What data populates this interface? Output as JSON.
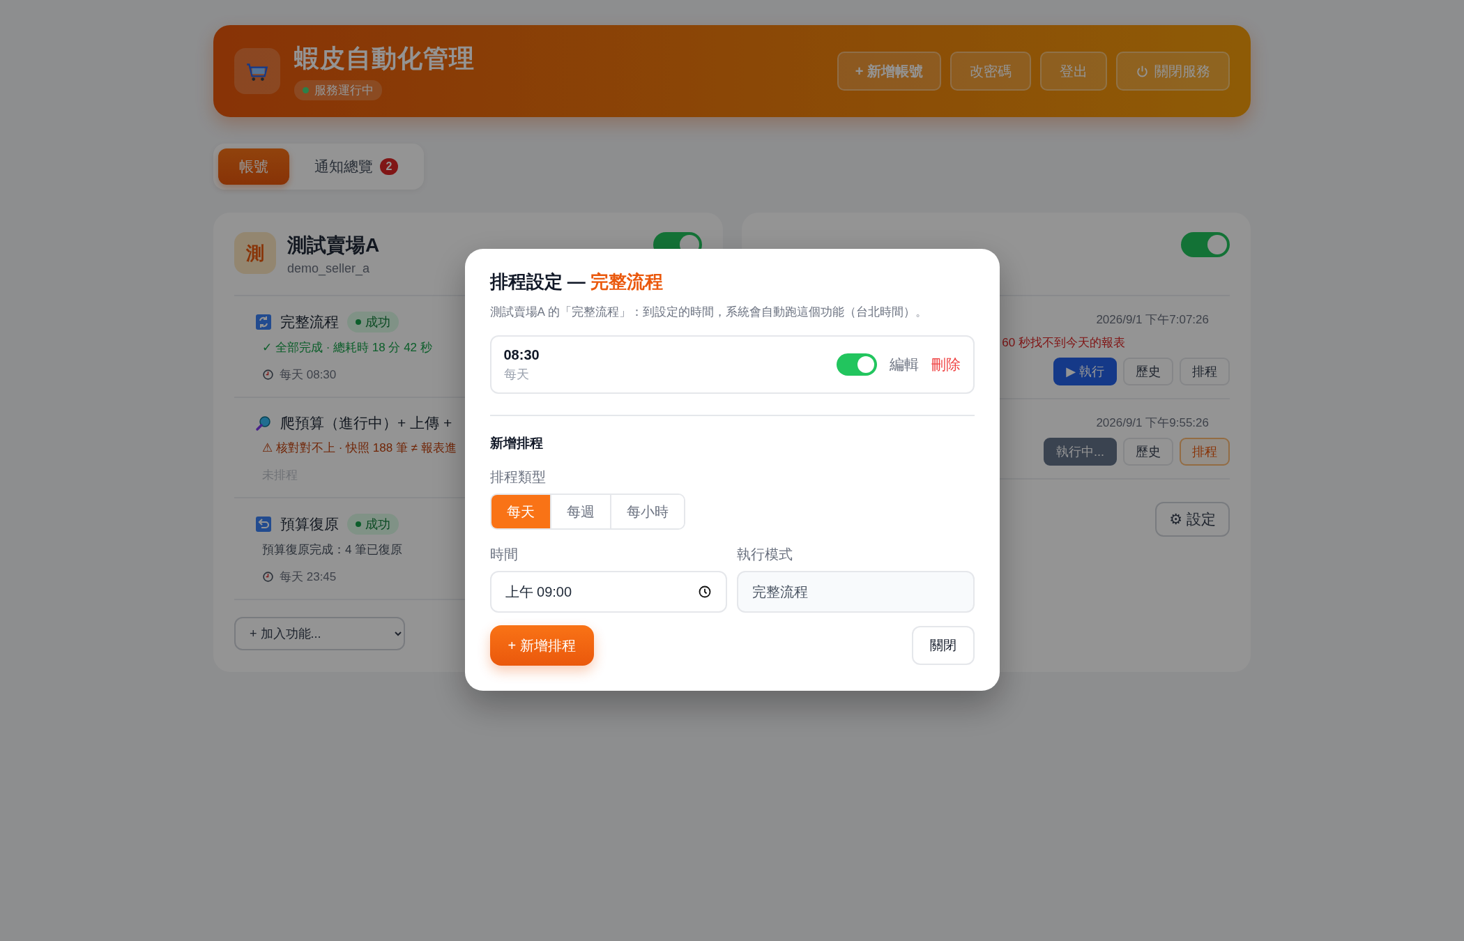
{
  "header": {
    "title": "蝦皮自動化管理",
    "status": "服務運行中",
    "buttons": [
      {
        "kind": "add",
        "label": "+ 新增帳號"
      },
      {
        "kind": "plain",
        "label": "改密碼"
      },
      {
        "kind": "plain",
        "label": "登出"
      },
      {
        "kind": "power",
        "label": "關閉服務"
      }
    ]
  },
  "tabs": [
    {
      "label": "帳號",
      "selected": true
    },
    {
      "label": "通知總覽",
      "selected": false,
      "badge": "2"
    }
  ],
  "accounts": [
    {
      "avatar": "測",
      "name": "測試賣場A",
      "username": "demo_seller_a",
      "enabled": true,
      "tasks": [
        {
          "kind": "success",
          "name": "完整流程",
          "status": "成功",
          "message": "✓ 全部完成 · 總耗時 18 分 42 秒",
          "schedule": "每天 08:30",
          "scheduled": true
        },
        {
          "kind": "warning",
          "name": "爬預算（進行中）+ 上傳 +",
          "message": "⚠ 核對對不上 · 快照 188 筆 ≠ 報表進",
          "schedule": "未排程",
          "scheduled": false
        },
        {
          "kind": "neutral",
          "name": "預算復原",
          "status": "成功",
          "message": "預算復原完成：4 筆已復原",
          "schedule": "每天 23:45",
          "scheduled": true
        }
      ],
      "add_select": "+ 加入功能..."
    },
    {
      "enabled": true,
      "tasks": [
        {
          "kind": "error",
          "time": "2026/9/1 下午7:07:26",
          "message": "60 秒找不到今天的報表",
          "buttons": [
            {
              "kind": "run",
              "label": "▶ 執行",
              "disabled": false
            },
            {
              "kind": "plain",
              "label": "歷史"
            },
            {
              "kind": "plain",
              "label": "排程"
            }
          ]
        },
        {
          "time": "2026/9/1 下午9:55:26",
          "buttons": [
            {
              "kind": "run",
              "label": "執行中...",
              "disabled": true
            },
            {
              "kind": "plain",
              "label": "歷史"
            },
            {
              "kind": "highlight",
              "label": "排程"
            }
          ]
        }
      ],
      "settings_button": "⚙ 設定"
    }
  ],
  "modal": {
    "title": "排程設定 — ",
    "title_highlight": "完整流程",
    "description": "測試賣場A 的「完整流程」：到設定的時間，系統會自動跑這個功能（台北時間）。",
    "schedules": [
      {
        "time": "08:30",
        "frequency": "每天",
        "enabled": true,
        "edit": "編輯",
        "delete": "刪除"
      }
    ],
    "new_section": "新增排程",
    "type_label": "排程類型",
    "types": [
      {
        "label": "每天",
        "selected": true
      },
      {
        "label": "每週",
        "selected": false
      },
      {
        "label": "每小時",
        "selected": false
      }
    ],
    "time_label": "時間",
    "time_value": "上午 09:00",
    "mode_label": "執行模式",
    "mode_value": "完整流程",
    "add_button": "+ 新增排程",
    "close_button": "關閉"
  }
}
